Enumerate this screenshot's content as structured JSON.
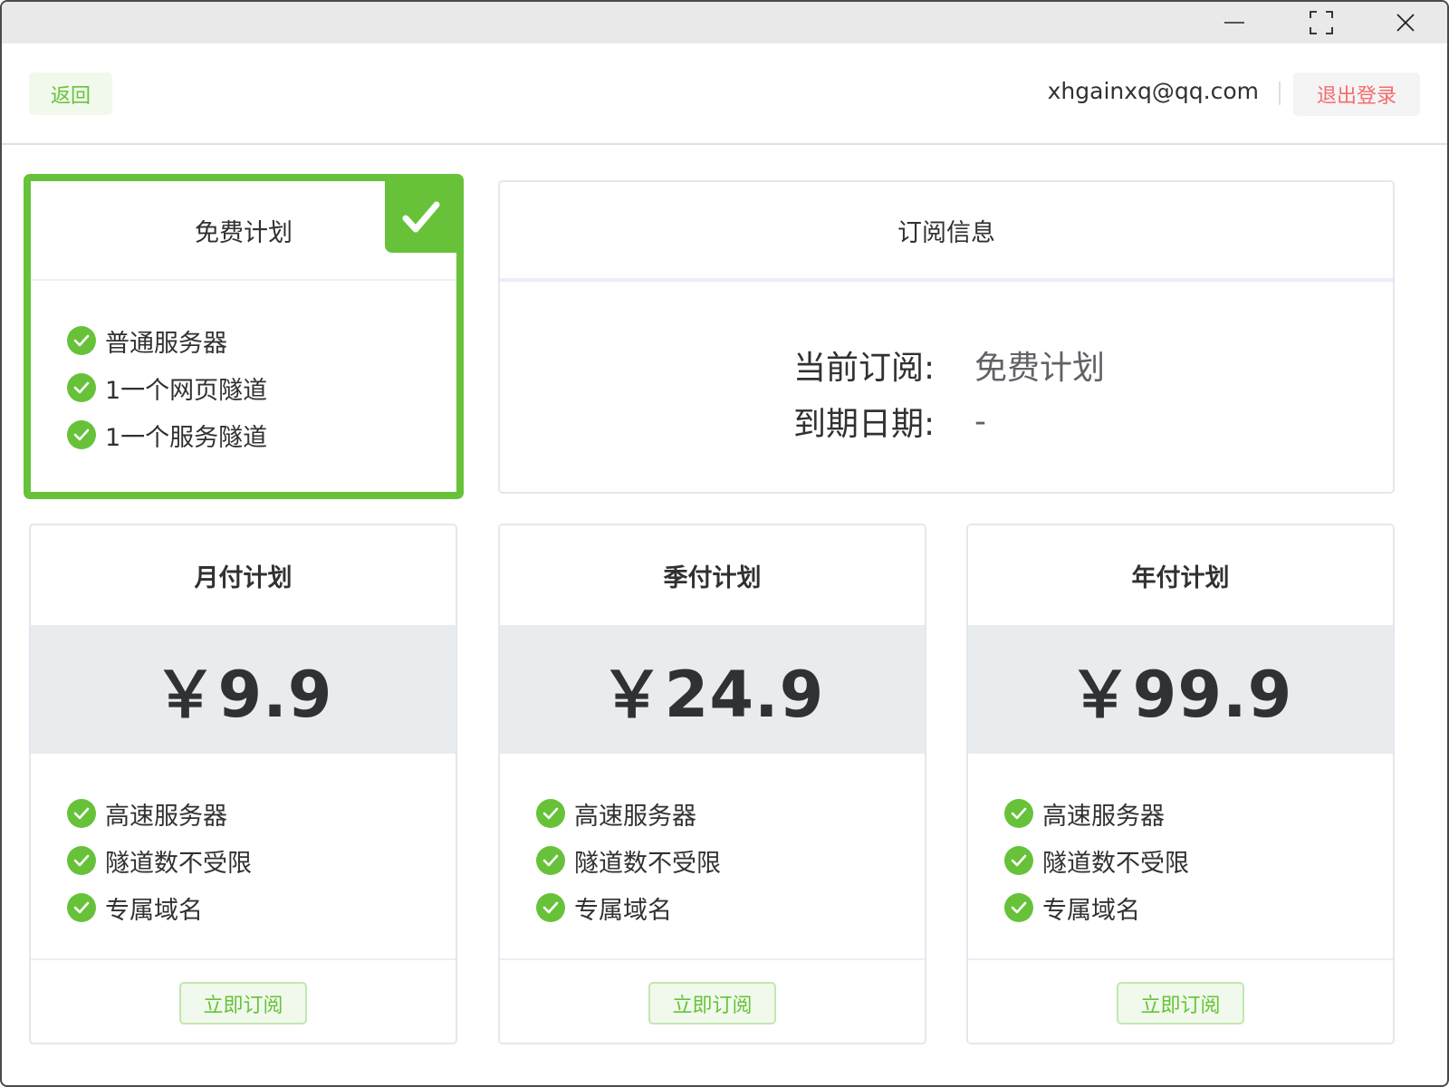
{
  "header": {
    "back_label": "返回",
    "user_email": "xhgainxq@qq.com",
    "logout_label": "退出登录"
  },
  "free_plan": {
    "title": "免费计划",
    "features": [
      "普通服务器",
      "1一个网页隧道",
      "1一个服务隧道"
    ]
  },
  "subscription_info": {
    "title": "订阅信息",
    "current_label": "当前订阅:",
    "current_value": "免费计划",
    "expiry_label": "到期日期:",
    "expiry_value": "-"
  },
  "plans": [
    {
      "title": "月付计划",
      "price": "￥9.9",
      "features": [
        "高速服务器",
        "隧道数不受限",
        "专属域名"
      ],
      "button": "立即订阅"
    },
    {
      "title": "季付计划",
      "price": "￥24.9",
      "features": [
        "高速服务器",
        "隧道数不受限",
        "专属域名"
      ],
      "button": "立即订阅"
    },
    {
      "title": "年付计划",
      "price": "￥99.9",
      "features": [
        "高速服务器",
        "隧道数不受限",
        "专属域名"
      ],
      "button": "立即订阅"
    }
  ],
  "colors": {
    "accent_green": "#67c23a",
    "danger_red": "#f56c6c",
    "price_band": "#e9ecef"
  },
  "icons": {
    "feature": "check-circle-icon",
    "selected": "checkmark-icon",
    "window": [
      "minimize-icon",
      "maximize-icon",
      "close-icon"
    ]
  }
}
